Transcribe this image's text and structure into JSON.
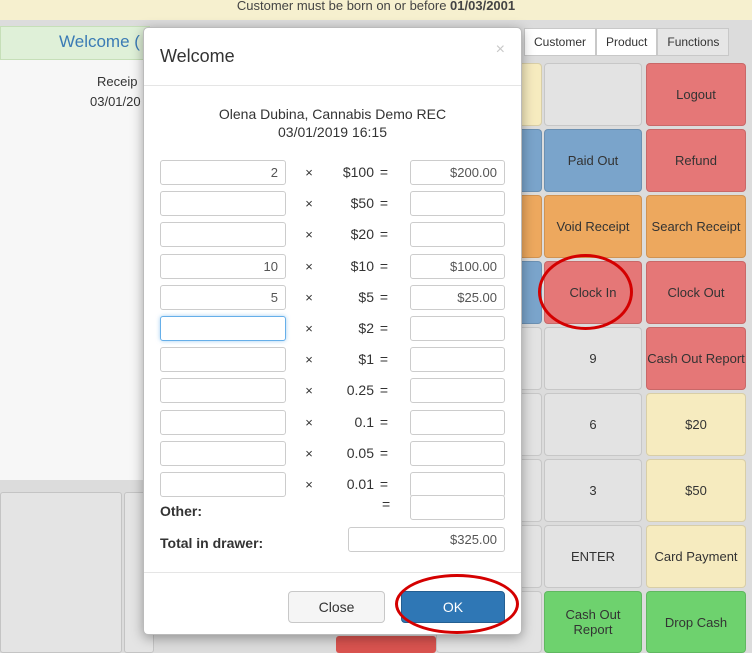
{
  "banner": {
    "prefix": "Customer must be born on or before ",
    "date": "01/03/2001"
  },
  "app": {
    "welcome_partial": "Welcome (",
    "receipt_label": "Receip",
    "receipt_date": "03/01/20"
  },
  "tabs": [
    {
      "label": "Customer"
    },
    {
      "label": "Product"
    },
    {
      "label": "Functions"
    }
  ],
  "grid": {
    "logout": "Logout",
    "paid_out": "Paid Out",
    "refund": "Refund",
    "void_receipt": "Void Receipt",
    "search_receipt": "Search Receipt",
    "clock_in": "Clock In",
    "clock_out": "Clock Out",
    "key_9": "9",
    "cash_out_report": "Cash Out Report",
    "key_6": "6",
    "amt_20": "$20",
    "key_3": "3",
    "amt_50": "$50",
    "enter": "ENTER",
    "card_payment": "Card Payment",
    "cash_out_report_2": "Cash Out Report",
    "drop_cash": "Drop Cash"
  },
  "modal": {
    "title": "Welcome",
    "close_glyph": "×",
    "user_line": "Olena Dubina, Cannabis Demo REC",
    "datetime": "03/01/2019 16:15",
    "times_glyph": "×",
    "eq_glyph": "=",
    "denominations": [
      {
        "label": "$100",
        "qty": "2",
        "amount": "$200.00"
      },
      {
        "label": "$50",
        "qty": "",
        "amount": ""
      },
      {
        "label": "$20",
        "qty": "",
        "amount": ""
      },
      {
        "label": "$10",
        "qty": "10",
        "amount": "$100.00"
      },
      {
        "label": "$5",
        "qty": "5",
        "amount": "$25.00"
      },
      {
        "label": "$2",
        "qty": "",
        "amount": ""
      },
      {
        "label": "$1",
        "qty": "",
        "amount": ""
      },
      {
        "label": "0.25",
        "qty": "",
        "amount": ""
      },
      {
        "label": "0.1",
        "qty": "",
        "amount": ""
      },
      {
        "label": "0.05",
        "qty": "",
        "amount": ""
      },
      {
        "label": "0.01",
        "qty": "",
        "amount": ""
      }
    ],
    "other_label": "Other:",
    "other_amount": "",
    "total_label": "Total in drawer:",
    "total_amount": "$325.00",
    "close_button": "Close",
    "ok_button": "OK"
  },
  "colors": {
    "primary": "#2f77b5",
    "annotation_red": "#d40000",
    "tile_red": "#e57777",
    "tile_blue": "#7aa4cb",
    "tile_orange": "#eda85e",
    "tile_green": "#6ed26e",
    "tile_yellow": "#f6ebbf"
  }
}
